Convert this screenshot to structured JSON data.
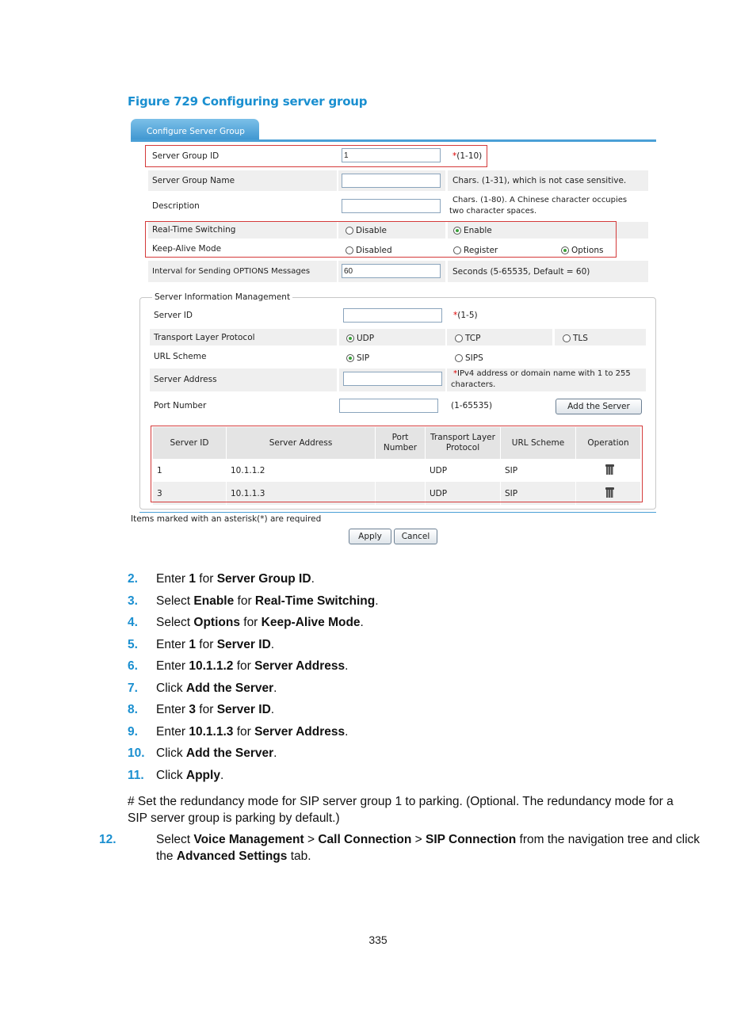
{
  "figure_title": "Figure 729 Configuring server group",
  "ui": {
    "tab_label": "Configure Server Group",
    "server_group_id": {
      "label": "Server Group ID",
      "value": "1",
      "hint_req": "*",
      "hint": "(1-10)"
    },
    "server_group_name": {
      "label": "Server Group Name",
      "value": "",
      "hint": "Chars. (1-31), which is not case sensitive."
    },
    "description": {
      "label": "Description",
      "value": "",
      "hint_line1": "Chars. (1-80). A Chinese character occupies",
      "hint_line2": "two character spaces."
    },
    "real_time_switching": {
      "label": "Real-Time Switching",
      "options": [
        "Disable",
        "Enable"
      ],
      "selected": "Enable"
    },
    "keep_alive_mode": {
      "label": "Keep-Alive Mode",
      "options": [
        "Disabled",
        "Register",
        "Options"
      ],
      "selected": "Options"
    },
    "interval": {
      "label": "Interval for Sending OPTIONS Messages",
      "value": "60",
      "hint": "Seconds (5-65535, Default = 60)"
    },
    "server_info": {
      "legend": "Server Information Management",
      "server_id": {
        "label": "Server ID",
        "value": "",
        "hint_req": "*",
        "hint": "(1-5)"
      },
      "transport": {
        "label": "Transport Layer Protocol",
        "options": [
          "UDP",
          "TCP",
          "TLS"
        ],
        "selected": "UDP"
      },
      "url_scheme": {
        "label": "URL Scheme",
        "options": [
          "SIP",
          "SIPS"
        ],
        "selected": "SIP"
      },
      "server_address": {
        "label": "Server Address",
        "value": "",
        "hint_req": "*",
        "hint_line1": "IPv4 address or domain name with 1 to 255",
        "hint_line2": "characters."
      },
      "port_number": {
        "label": "Port Number",
        "value": "",
        "hint": "(1-65535)"
      },
      "add_button": "Add the Server",
      "table": {
        "headers": [
          "Server ID",
          "Server Address",
          "Port Number",
          "Transport Layer Protocol",
          "URL Scheme",
          "Operation"
        ],
        "header_lines": [
          [
            "Server ID"
          ],
          [
            "Server Address"
          ],
          [
            "Port",
            "Number"
          ],
          [
            "Transport Layer",
            "Protocol"
          ],
          [
            "URL Scheme"
          ],
          [
            "Operation"
          ]
        ],
        "rows": [
          {
            "server_id": "1",
            "address": "10.1.1.2",
            "port": "",
            "protocol": "UDP",
            "scheme": "SIP",
            "operation": "delete-icon"
          },
          {
            "server_id": "3",
            "address": "10.1.1.3",
            "port": "",
            "protocol": "UDP",
            "scheme": "SIP",
            "operation": "delete-icon"
          }
        ]
      }
    },
    "required_note": "Items marked with an asterisk(*) are required",
    "apply_button": "Apply",
    "cancel_button": "Cancel"
  },
  "steps": [
    {
      "num": "2.",
      "parts": [
        [
          "Enter ",
          false
        ],
        [
          "1",
          true
        ],
        [
          " for ",
          false
        ],
        [
          "Server Group ID",
          true
        ],
        [
          ".",
          false
        ]
      ]
    },
    {
      "num": "3.",
      "parts": [
        [
          "Select ",
          false
        ],
        [
          "Enable",
          true
        ],
        [
          " for ",
          false
        ],
        [
          "Real-Time Switching",
          true
        ],
        [
          ".",
          false
        ]
      ]
    },
    {
      "num": "4.",
      "parts": [
        [
          "Select ",
          false
        ],
        [
          "Options",
          true
        ],
        [
          " for ",
          false
        ],
        [
          "Keep-Alive Mode",
          true
        ],
        [
          ".",
          false
        ]
      ]
    },
    {
      "num": "5.",
      "parts": [
        [
          "Enter ",
          false
        ],
        [
          "1",
          true
        ],
        [
          " for ",
          false
        ],
        [
          "Server ID",
          true
        ],
        [
          ".",
          false
        ]
      ]
    },
    {
      "num": "6.",
      "parts": [
        [
          "Enter ",
          false
        ],
        [
          "10.1.1.2",
          true
        ],
        [
          " for ",
          false
        ],
        [
          "Server Address",
          true
        ],
        [
          ".",
          false
        ]
      ]
    },
    {
      "num": "7.",
      "parts": [
        [
          "Click ",
          false
        ],
        [
          "Add the Server",
          true
        ],
        [
          ".",
          false
        ]
      ]
    },
    {
      "num": "8.",
      "parts": [
        [
          "Enter ",
          false
        ],
        [
          "3",
          true
        ],
        [
          " for ",
          false
        ],
        [
          "Server ID",
          true
        ],
        [
          ".",
          false
        ]
      ]
    },
    {
      "num": "9.",
      "parts": [
        [
          "Enter ",
          false
        ],
        [
          "10.1.1.3",
          true
        ],
        [
          " for ",
          false
        ],
        [
          "Server Address",
          true
        ],
        [
          ".",
          false
        ]
      ]
    },
    {
      "num": "10.",
      "parts": [
        [
          "Click ",
          false
        ],
        [
          "Add the Server",
          true
        ],
        [
          ".",
          false
        ]
      ]
    },
    {
      "num": "11.",
      "parts": [
        [
          "Click ",
          false
        ],
        [
          "Apply",
          true
        ],
        [
          ".",
          false
        ]
      ]
    }
  ],
  "comment": "# Set the redundancy mode for SIP server group 1 to parking. (Optional. The redundancy mode for a SIP server group is parking by default.)",
  "step12": {
    "num": "12.",
    "parts": [
      [
        "Select ",
        false
      ],
      [
        "Voice Management",
        true
      ],
      [
        " > ",
        false
      ],
      [
        "Call Connection",
        true
      ],
      [
        " > ",
        false
      ],
      [
        "SIP Connection",
        true
      ],
      [
        " from the navigation tree and click the ",
        false
      ],
      [
        "Advanced Settings",
        true
      ],
      [
        " tab.",
        false
      ]
    ]
  },
  "page_number": "335"
}
